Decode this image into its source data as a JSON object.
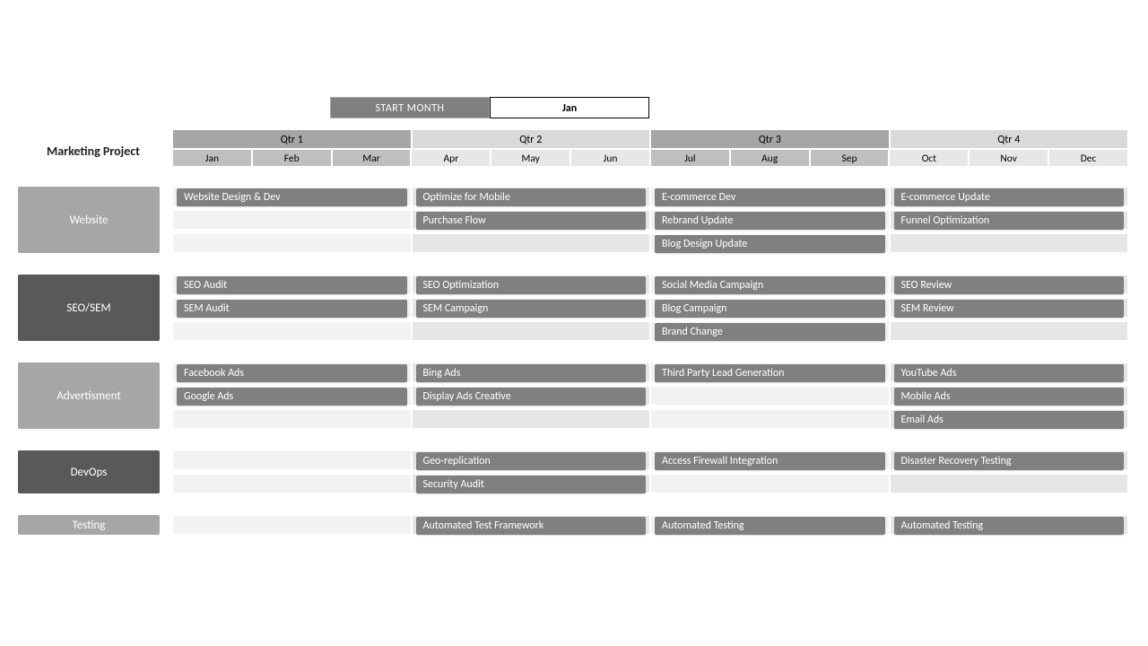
{
  "header": {
    "title": "Marketing Project",
    "start_month_label": "START MONTH",
    "start_month_value": "Jan"
  },
  "timeline": {
    "quarters": [
      "Qtr 1",
      "Qtr 2",
      "Qtr 3",
      "Qtr 4"
    ],
    "months": [
      "Jan",
      "Feb",
      "Mar",
      "Apr",
      "May",
      "Jun",
      "Jul",
      "Aug",
      "Sep",
      "Oct",
      "Nov",
      "Dec"
    ]
  },
  "lanes": [
    {
      "name": "Website",
      "color": "light",
      "rows": [
        [
          "Website Design & Dev",
          "Optimize for Mobile",
          "E-commerce Dev",
          "E-commerce Update"
        ],
        [
          "",
          "Purchase Flow",
          "Rebrand Update",
          "Funnel Optimization"
        ],
        [
          "",
          "",
          "Blog Design Update",
          ""
        ]
      ]
    },
    {
      "name": "SEO/SEM",
      "color": "dark",
      "rows": [
        [
          "SEO Audit",
          "SEO Optimization",
          "Social Media Campaign",
          "SEO Review"
        ],
        [
          "SEM Audit",
          "SEM Campaign",
          "Blog Campaign",
          "SEM Review"
        ],
        [
          "",
          "",
          "Brand Change",
          ""
        ]
      ]
    },
    {
      "name": "Advertisment",
      "color": "light",
      "rows": [
        [
          "Facebook Ads",
          "Bing Ads",
          "Third Party Lead Generation",
          "YouTube Ads"
        ],
        [
          "Google Ads",
          "Display Ads Creative",
          "",
          "Mobile Ads"
        ],
        [
          "",
          "",
          "",
          "Email Ads"
        ]
      ]
    },
    {
      "name": "DevOps",
      "color": "dark",
      "rows": [
        [
          "",
          "Geo-replication",
          "Access Firewall Integration",
          "Disaster Recovery Testing"
        ],
        [
          "",
          "Security Audit",
          "",
          ""
        ]
      ]
    },
    {
      "name": "Testing",
      "color": "light",
      "rows": [
        [
          "",
          "Automated Test Framework",
          "Automated Testing",
          "Automated Testing"
        ]
      ]
    }
  ]
}
